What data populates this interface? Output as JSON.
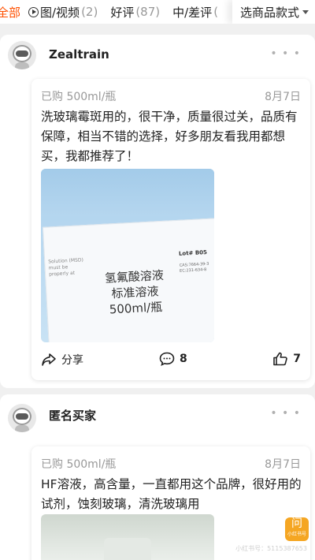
{
  "tabs": {
    "all": "全部",
    "video_label": "图/视频",
    "video_count": "(2)",
    "good_label": "好评",
    "good_count": "(87)",
    "bad_label": "中/差评",
    "bad_count": "(",
    "style_label": "选商品款式"
  },
  "reviews": [
    {
      "username": "Zealtrain",
      "sku": "已购 500ml/瓶",
      "date": "8月7日",
      "text": "洗玻璃霉斑用的，很干净，质量很过关，品质有保障，相当不错的选择，好多朋友看我用都想买，我都推荐了！",
      "photo": {
        "main_text_1": "氢氟酸溶液",
        "main_text_2": "标准溶液",
        "main_text_3": "500ml/瓶",
        "lot": "Lot# B05",
        "small_left": "Solution (MSD) must be properly at",
        "meta": "CAS:7664-39-3 EC:231-634-8"
      },
      "share_label": "分享",
      "comment_count": "8",
      "like_count": "7"
    },
    {
      "username": "匿名买家",
      "sku": "已购 500ml/瓶",
      "date": "8月7日",
      "text": "HF溶液，高含量，一直都用这个品牌，很好用的试剂，蚀刻玻璃，清洗玻璃用"
    }
  ],
  "watermark": {
    "glyph": "问",
    "sub": "小红书号",
    "id": "小红书号：5115387653"
  },
  "colors": {
    "accent": "#ff5000",
    "muted": "#999999"
  }
}
